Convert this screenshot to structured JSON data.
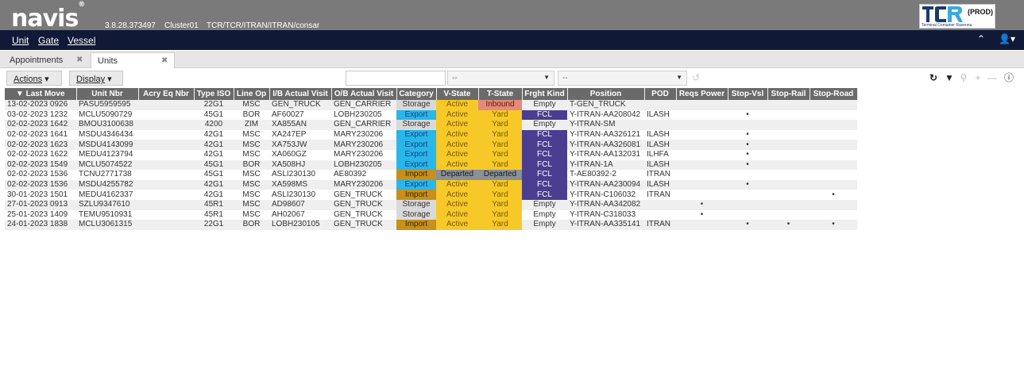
{
  "header": {
    "logo_text": "navis",
    "logo_mark": "®",
    "version": "3.8.28.373497",
    "cluster": "Cluster01",
    "scope": "TCR/TCR/ITRAN/ITRAN/consar",
    "env_badge": "(PROD)",
    "brand_text": "TCR",
    "brand_subtitle": "Terminal Container Ravenna"
  },
  "menu": {
    "items": [
      "Unit",
      "Gate",
      "Vessel"
    ]
  },
  "tabs": [
    {
      "label": "Appointments",
      "active": false
    },
    {
      "label": "Units",
      "active": true
    }
  ],
  "toolbar": {
    "actions_label": "Actions",
    "display_label": "Display",
    "search_value": "",
    "filter1_value": "--",
    "filter2_value": "--"
  },
  "table": {
    "columns": [
      "Last Move",
      "Unit Nbr",
      "Acry Eq Nbr",
      "Type ISO",
      "Line Op",
      "I/B Actual Visit",
      "O/B Actual Visit",
      "Category",
      "V-State",
      "T-State",
      "Frght Kind",
      "Position",
      "POD",
      "Reqs Power",
      "Stop-Vsl",
      "Stop-Rail",
      "Stop-Road"
    ],
    "rows": [
      [
        "13-02-2023 0926",
        "PASU5959595",
        "",
        "22G1",
        "MSC",
        "GEN_TRUCK",
        "GEN_CARRIER",
        "Storage",
        "Active",
        "Inbound",
        "Empty",
        "T-GEN_TRUCK",
        "",
        "",
        "",
        "",
        ""
      ],
      [
        "03-02-2023 1232",
        "MCLU5090729",
        "",
        "45G1",
        "BOR",
        "AF60027",
        "LOBH230205",
        "Export",
        "Active",
        "Yard",
        "FCL",
        "Y-ITRAN-AA208042",
        "ILASH",
        "",
        "•",
        "",
        ""
      ],
      [
        "02-02-2023 1642",
        "BMOU3100638",
        "",
        "4200",
        "ZIM",
        "XA855AN",
        "GEN_CARRIER",
        "Storage",
        "Active",
        "Yard",
        "Empty",
        "Y-ITRAN-SM",
        "",
        "",
        "",
        "",
        ""
      ],
      [
        "02-02-2023 1641",
        "MSDU4346434",
        "",
        "42G1",
        "MSC",
        "XA247EP",
        "MARY230206",
        "Export",
        "Active",
        "Yard",
        "FCL",
        "Y-ITRAN-AA326121",
        "ILASH",
        "",
        "•",
        "",
        ""
      ],
      [
        "02-02-2023 1623",
        "MSDU4143099",
        "",
        "42G1",
        "MSC",
        "XA753JW",
        "MARY230206",
        "Export",
        "Active",
        "Yard",
        "FCL",
        "Y-ITRAN-AA326081",
        "ILASH",
        "",
        "•",
        "",
        ""
      ],
      [
        "02-02-2023 1622",
        "MEDU4123794",
        "",
        "42G1",
        "MSC",
        "XA060GZ",
        "MARY230206",
        "Export",
        "Active",
        "Yard",
        "FCL",
        "Y-ITRAN-AA132031",
        "ILHFA",
        "",
        "•",
        "",
        ""
      ],
      [
        "02-02-2023 1549",
        "MCLU5074522",
        "",
        "45G1",
        "BOR",
        "XA508HJ",
        "LOBH230205",
        "Export",
        "Active",
        "Yard",
        "FCL",
        "Y-ITRAN-1A",
        "ILASH",
        "",
        "•",
        "",
        ""
      ],
      [
        "02-02-2023 1536",
        "TCNU2771738",
        "",
        "45G1",
        "MSC",
        "ASLI230130",
        "AE80392",
        "Import",
        "Departed",
        "Departed",
        "FCL",
        "T-AE80392-2",
        "ITRAN",
        "",
        "",
        "",
        ""
      ],
      [
        "02-02-2023 1536",
        "MSDU4255782",
        "",
        "42G1",
        "MSC",
        "XA598MS",
        "MARY230206",
        "Export",
        "Active",
        "Yard",
        "FCL",
        "Y-ITRAN-AA230094",
        "ILASH",
        "",
        "•",
        "",
        ""
      ],
      [
        "30-01-2023 1501",
        "MEDU4162337",
        "",
        "42G1",
        "MSC",
        "ASLI230130",
        "GEN_TRUCK",
        "Import",
        "Active",
        "Yard",
        "FCL",
        "Y-ITRAN-C106032",
        "ITRAN",
        "",
        "",
        "",
        "•"
      ],
      [
        "27-01-2023 0913",
        "SZLU9347610",
        "",
        "45R1",
        "MSC",
        "AD98607",
        "GEN_TRUCK",
        "Storage",
        "Active",
        "Yard",
        "Empty",
        "Y-ITRAN-AA342082",
        "",
        "•",
        "",
        "",
        ""
      ],
      [
        "25-01-2023 1409",
        "TEMU9510931",
        "",
        "45R1",
        "MSC",
        "AH02067",
        "GEN_TRUCK",
        "Storage",
        "Active",
        "Yard",
        "Empty",
        "Y-ITRAN-C318033",
        "",
        "•",
        "",
        "",
        ""
      ],
      [
        "24-01-2023 1838",
        "MCLU3061315",
        "",
        "22G1",
        "BOR",
        "LOBH230105",
        "GEN_TRUCK",
        "Import",
        "Active",
        "Yard",
        "Empty",
        "Y-ITRAN-AA335141",
        "ITRAN",
        "",
        "•",
        "•",
        "•"
      ]
    ]
  },
  "colors": {
    "topbar": "#7a7a7a",
    "menubar": "#101a36",
    "export": "#29b6e8",
    "import": "#c8901a",
    "storage": "#d9d9d9",
    "active_yard": "#f7c928",
    "departed": "#8a8f98",
    "inbound": "#e58a7a",
    "fcl": "#4b3d8f"
  },
  "icons": [
    "refresh-icon",
    "filter-icon",
    "search-icon",
    "add-icon",
    "remove-icon",
    "help-icon",
    "user-icon",
    "collapse-icon",
    "sort-desc-icon"
  ]
}
